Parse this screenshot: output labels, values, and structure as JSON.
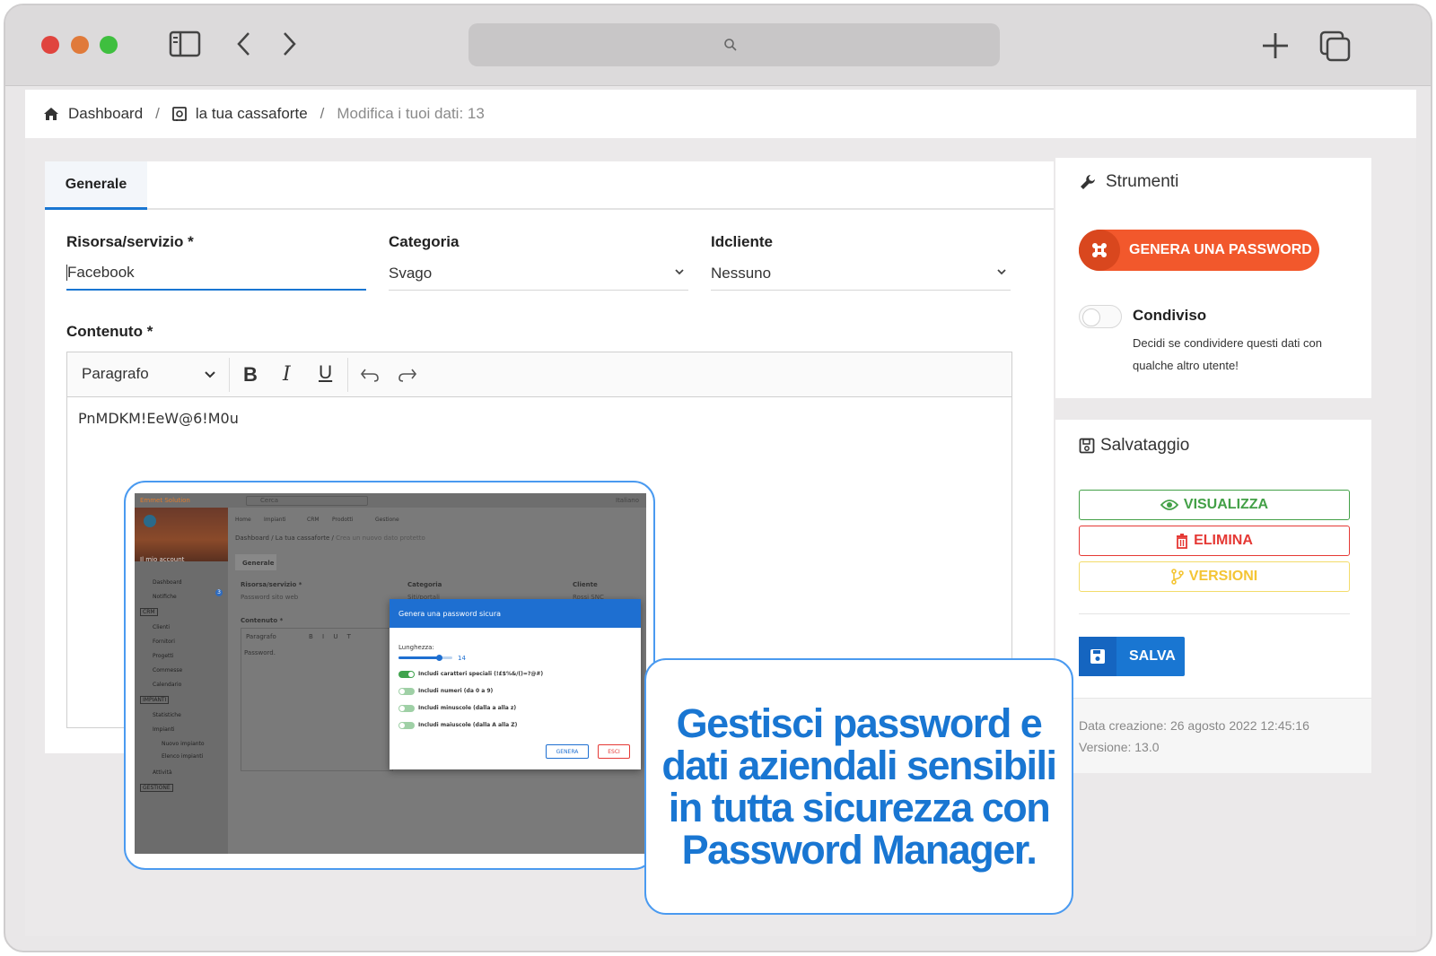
{
  "breadcrumb": {
    "items": [
      "Dashboard",
      "la tua cassaforte",
      "Modifica i tuoi dati: 13"
    ],
    "separator": "/"
  },
  "form": {
    "tab_label": "Generale",
    "risorsa": {
      "label": "Risorsa/servizio *",
      "value": "Facebook"
    },
    "categoria": {
      "label": "Categoria",
      "value": "Svago"
    },
    "idcliente": {
      "label": "Idcliente",
      "value": "Nessuno"
    },
    "contenuto": {
      "label": "Contenuto *"
    },
    "editor": {
      "format_label": "Paragrafo",
      "text": "PnMDKM!EeW@6!M0u"
    }
  },
  "tools": {
    "title": "Strumenti",
    "generate_label": "GENERA UNA PASSWORD",
    "shared_label": "Condiviso",
    "shared_desc_line1": "Decidi se condividere questi dati con",
    "shared_desc_line2": "qualche altro utente!",
    "shared_on": false
  },
  "save": {
    "title": "Salvataggio",
    "view_label": "VISUALIZZA",
    "delete_label": "ELIMINA",
    "versions_label": "VERSIONI",
    "save_label": "SALVA",
    "created": "Data creazione: 26 agosto 2022 12:45:16",
    "version": "Versione: 13.0"
  },
  "screenshot": {
    "brand": "Emmet Solution",
    "search_placeholder": "Cerca",
    "language": "Italiano",
    "account": "Il mio account",
    "top_nav": [
      "Home",
      "Impianti",
      "CRM",
      "Prodotti",
      "Gestione"
    ],
    "breadcrumb": [
      "Dashboard",
      "La tua cassaforte",
      "Crea un nuovo dato protetto"
    ],
    "tab": "Generale",
    "sidebar": [
      "Dashboard",
      "Notifiche",
      "CRM",
      "Clienti",
      "Fornitori",
      "Progetti",
      "Commesse",
      "Calendario",
      "IMPIANTI",
      "Statistiche",
      "Impianti",
      "Nuovo impianto",
      "Elenco impianti",
      "Attività",
      "GESTIONE"
    ],
    "notifications_count": "3",
    "fields": {
      "risorsa_label": "Risorsa/servizio *",
      "risorsa_value": "Password sito web",
      "categoria_label": "Categoria",
      "categoria_value": "Siti/portali",
      "cliente_label": "Cliente",
      "cliente_value": "Rossi SNC",
      "contenuto_label": "Contenuto *",
      "editor_format": "Paragrafo",
      "editor_text": "Password."
    },
    "dialog": {
      "title": "Genera una password sicura",
      "length_label": "Lunghezza:",
      "length_value": "14",
      "length_fraction": 0.75,
      "options": [
        "Includi caratteri speciali (!£$%&/()=?@#)",
        "Includi numeri (da 0 a 9)",
        "Includi minuscole (dalla a alla z)",
        "Includi maiuscole (dalla A alla Z)"
      ],
      "option_states": [
        true,
        false,
        false,
        false
      ],
      "generate": "GENERA",
      "exit": "ESCI"
    }
  },
  "callout": {
    "text": "Gestisci password e dati aziendali sensibili in tutta sicurezza con Password Manager."
  },
  "colors": {
    "primary": "#1976d2",
    "orange": "#f2582c",
    "green": "#43a047",
    "red": "#e53935",
    "yellow": "#fbc02d"
  }
}
